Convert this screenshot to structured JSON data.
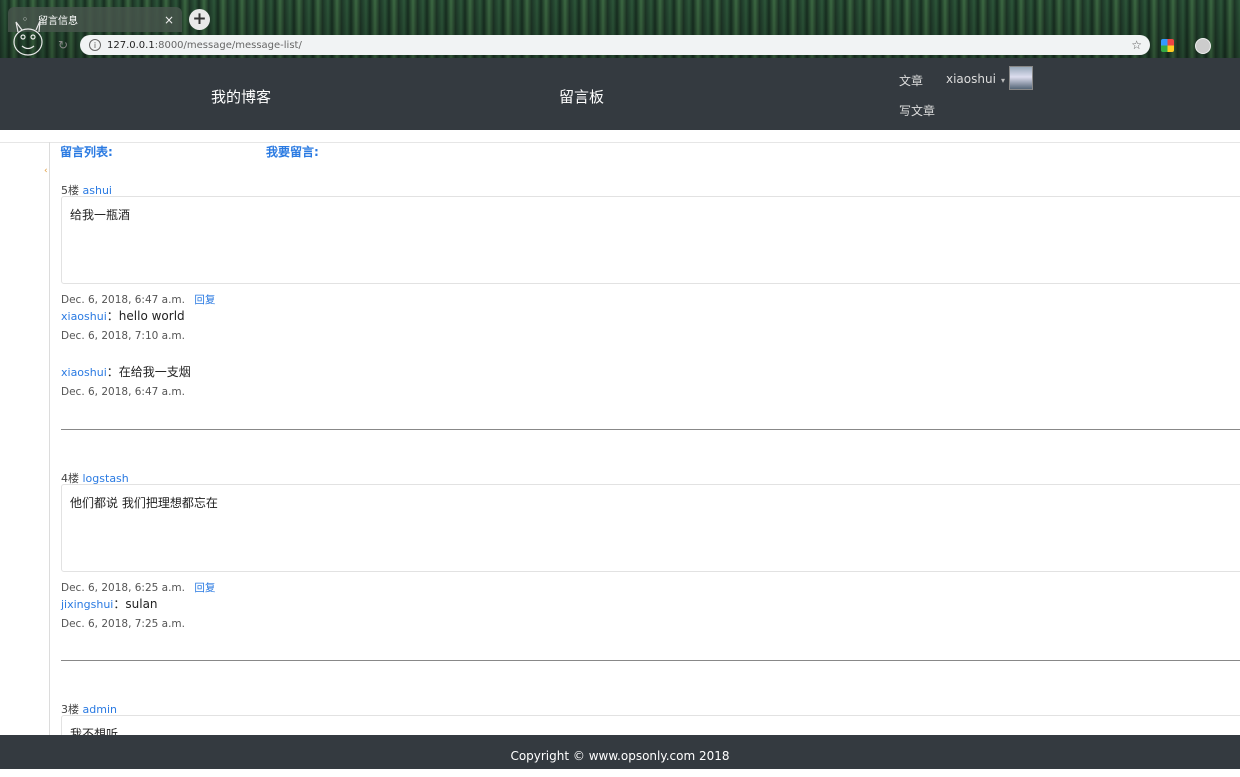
{
  "browser": {
    "tab_title": "留言信息",
    "tab_close": "×",
    "new_tab": "+",
    "url_host": "127.0.0.1",
    "url_path": ":8000/message/message-list/",
    "info_icon": "i",
    "star_icon": "☆",
    "reload_icon": "↻"
  },
  "navbar": {
    "brand": "我的博客",
    "board": "留言板",
    "articles": "文章",
    "user": "xiaoshui",
    "caret": "▾",
    "write": "写文章"
  },
  "tabs": {
    "list": "留言列表:",
    "post": "我要留言:"
  },
  "messages": [
    {
      "floor": "5楼",
      "author": "ashui",
      "body": "给我一瓶酒",
      "date": "Dec. 6, 2018, 6:47 a.m.",
      "reply_label": "回复",
      "replies": [
        {
          "user": "xiaoshui",
          "sep": "：",
          "text": "hello world",
          "date": "Dec. 6, 2018, 7:10 a.m."
        },
        {
          "user": "xiaoshui",
          "sep": "：",
          "text": "在给我一支烟",
          "date": "Dec. 6, 2018, 6:47 a.m."
        }
      ]
    },
    {
      "floor": "4楼",
      "author": "logstash",
      "body": "他们都说 我们把理想都忘在",
      "date": "Dec. 6, 2018, 6:25 a.m.",
      "reply_label": "回复",
      "replies": [
        {
          "user": "jixingshui",
          "sep": "：",
          "text": "sulan",
          "date": "Dec. 6, 2018, 7:25 a.m."
        }
      ]
    },
    {
      "floor": "3楼",
      "author": "admin",
      "body": "我不想听",
      "date": "",
      "reply_label": "",
      "replies": []
    }
  ],
  "footer": {
    "text": "Copyright © www.opsonly.com 2018"
  },
  "colors": {
    "navbar": "#343a40",
    "link": "#2a7ae2"
  }
}
